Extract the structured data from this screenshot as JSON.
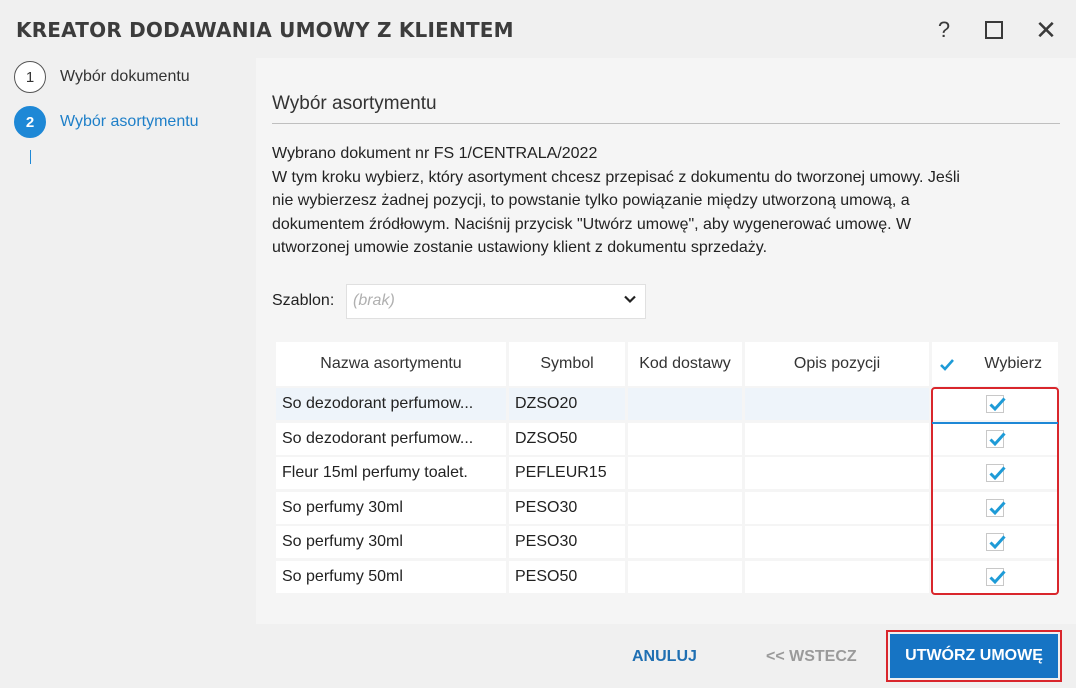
{
  "window": {
    "title": "KREATOR DODAWANIA UMOWY Z KLIENTEM",
    "help_label": "?",
    "close_label": "✕"
  },
  "steps": [
    {
      "number": "1",
      "label": "Wybór dokumentu",
      "active": false
    },
    {
      "number": "2",
      "label": "Wybór asortymentu",
      "active": true
    }
  ],
  "content": {
    "title": "Wybór asortymentu",
    "description_lines": [
      "Wybrano dokument nr FS 1/CENTRALA/2022",
      "W tym kroku wybierz, który asortyment chcesz przepisać z dokumentu do tworzonej umowy. Jeśli",
      "nie wybierzesz żadnej pozycji, to powstanie tylko powiązanie między utworzoną umową, a",
      "dokumentem źródłowym. Naciśnij przycisk \"Utwórz umowę\", aby wygenerować umowę. W",
      "utworzonej umowie zostanie ustawiony klient z dokumentu sprzedaży."
    ],
    "template": {
      "label": "Szablon:",
      "value": "(brak)"
    }
  },
  "table": {
    "columns": [
      "Nazwa asortymentu",
      "Symbol",
      "Kod dostawy",
      "Opis pozycji",
      "Wybierz"
    ],
    "select_all_checked": true,
    "rows": [
      {
        "name": "So dezodorant perfumow...",
        "symbol": "DZSO20",
        "kod": "",
        "opis": "",
        "checked": true
      },
      {
        "name": "So dezodorant perfumow...",
        "symbol": "DZSO50",
        "kod": "",
        "opis": "",
        "checked": true
      },
      {
        "name": "Fleur 15ml perfumy toalet.",
        "symbol": "PEFLEUR15",
        "kod": "",
        "opis": "",
        "checked": true
      },
      {
        "name": "So perfumy 30ml",
        "symbol": "PESO30",
        "kod": "",
        "opis": "",
        "checked": true
      },
      {
        "name": "So perfumy 30ml",
        "symbol": "PESO30",
        "kod": "",
        "opis": "",
        "checked": true
      },
      {
        "name": "So perfumy 50ml",
        "symbol": "PESO50",
        "kod": "",
        "opis": "",
        "checked": true
      }
    ]
  },
  "footer": {
    "cancel_label": "ANULUJ",
    "back_label": "<< WSTECZ",
    "create_label": "UTWÓRZ UMOWĘ"
  },
  "colors": {
    "accent": "#1e88d6",
    "primary_button": "#1674c4",
    "highlight_border": "#d9262c",
    "check_mark": "#1e9bd7"
  }
}
